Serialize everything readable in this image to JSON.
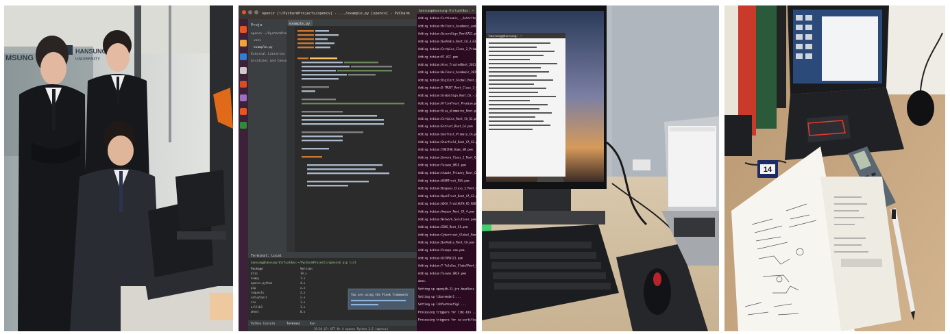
{
  "photos": [
    {
      "id": "photo-1",
      "logo_left": "MSUNG",
      "logo_center": "HANSUNG",
      "logo_center_sub": "UNIVERSITY"
    },
    {
      "id": "photo-2",
      "window_title": "opencv [~/PycharmProjects/opencv] - .../example.py [opencv] - PyCharm",
      "project_label": "Proje",
      "tree_items": [
        "opencv ~/PycharmProjects",
        "venv",
        "example.py",
        "External Libraries",
        "Scratches and Conso"
      ],
      "editor_tab": "example.py",
      "terminal_tabs": [
        "Terminal:",
        "Local"
      ],
      "terminal_cmd": "hansung@hansung-VirtualBox:~/PycharmProjects/opencv$ pip list",
      "table_header": [
        "Package",
        "Version"
      ],
      "packages": [
        [
          "dlib",
          "19.x"
        ],
        [
          "numpy",
          "1.x"
        ],
        [
          "opencv-python",
          "4.x"
        ],
        [
          "pip",
          "x.x"
        ],
        [
          "requests",
          "2.x"
        ],
        [
          "setuptools",
          "x.x"
        ],
        [
          "six",
          "1.x"
        ],
        [
          "urllib3",
          "1.x"
        ],
        [
          "wheel",
          "0.x"
        ]
      ],
      "notification_title": "You are using the Flask framework",
      "bottom_tabs": [
        "Python Console",
        "Terminal",
        "Run"
      ],
      "status_bar": "19:34  LF+  UTF-8+  4 spaces  Python 3.5 (opencv)",
      "right_terminal_title": "hansung@hansung-VirtualBox: ~",
      "right_terminal_lines": [
        "Adding debian:Certinomis_-_Autorite_Racine.pem",
        "Adding debian:Hellenic_Academic_and_Res...",
        "Adding debian:SecureSign_RootCA11.pem",
        "Adding debian:QuoVadis_Root_CA_3_G3.pem",
        "Adding debian:Certplus_Class_2_Primary_CA.pem",
        "Adding debian:EC-ACC.pem",
        "Adding debian:Atos_TrustedRoot_2011.pem",
        "Adding debian:Hellenic_Academic_2015.pem",
        "Adding debian:DigiCert_Global_Root_G3.pem",
        "Adding debian:D-TRUST_Root_Class_3_CA_2.pem",
        "Adding debian:GlobalSign_Root_CA_-_R2.pem",
        "Adding debian:AffirmTrust_Premium.pem",
        "Adding debian:Visa_eCommerce_Root.pem",
        "Adding debian:Certplus_Root_CA_G2.pem",
        "Adding debian:Entrust_Root_CA.pem",
        "Adding debian:GeoTrust_Primary_CA.pem",
        "Adding debian:Starfield_Root_CA_G2.pem",
        "Adding debian:TUBITAK_Kamu_SM.pem",
        "Adding debian:Sonera_Class_2_Root_CA.pem",
        "Adding debian:Taiwan_GRCA.pem",
        "Adding debian:thawte_Primary_Root_CA.pem",
        "Adding debian:USERTrust_RSA.pem",
        "Adding debian:Buypass_Class_3_Root_CA.pem",
        "Adding debian:OpenTrust_Root_CA_G2.pem",
        "Adding debian:GDCA_TrustAUTH_R5_ROOT.pem",
        "Adding debian:Amazon_Root_CA_4.pem",
        "Adding debian:Network_Solutions.pem",
        "Adding debian:ISRG_Root_X1.pem",
        "Adding debian:Cybertrust_Global_Root.pem",
        "Adding debian:QuoVadis_Root_CA.pem",
        "Adding debian:Izenpe.com.pem",
        "Adding debian:ACCVRAIZ1.pem",
        "Adding debian:T-TeleSec_GlobalRoot_Class_2.pem",
        "Adding debian:Taiwan_GRCA.pem",
        "done.",
        "Setting up openjdk-11-jre-headless ...",
        "Setting up libxrender1 ...",
        "Setting up libfontconfig1 ...",
        "Processing triggers for libc-bin ...",
        "Processing triggers for ca-certificates ..."
      ]
    },
    {
      "id": "photo-3",
      "terminal_title": "hansung@hansung: ~"
    },
    {
      "id": "photo-4",
      "card_number": "14"
    }
  ]
}
